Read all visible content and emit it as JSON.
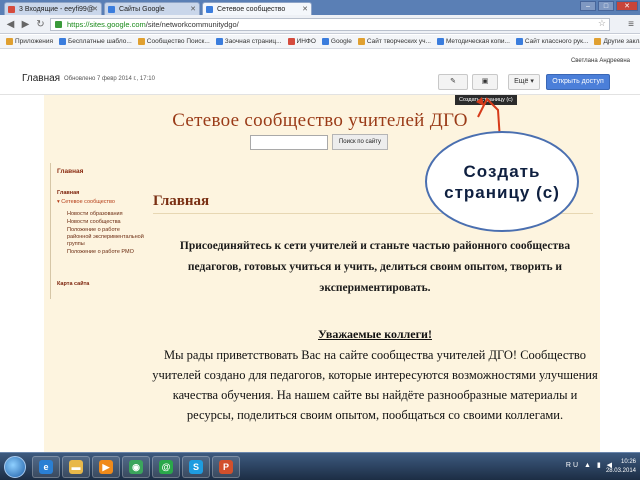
{
  "tabs": [
    {
      "label": "3 Входящие - eeyfi99@",
      "favicon_color": "#d54b3d"
    },
    {
      "label": "Сайты Google",
      "favicon_color": "#3b7ddd"
    },
    {
      "label": "Сетевое сообщество",
      "favicon_color": "#3b7ddd",
      "active": true
    }
  ],
  "address": {
    "scheme": "https://",
    "host": "sites.google.com",
    "path": "/site/networkcommunitydgo/"
  },
  "bookmarks": [
    {
      "label": "Приложения",
      "color": "#e0a030"
    },
    {
      "label": "Бесплатные шабло...",
      "color": "#3b7ddd"
    },
    {
      "label": "Сообщество Поиск...",
      "color": "#e0a030"
    },
    {
      "label": "Заочная страниц...",
      "color": "#3b7ddd"
    },
    {
      "label": "ИНФО",
      "color": "#d54b3d"
    },
    {
      "label": "Google",
      "color": "#3b7ddd"
    },
    {
      "label": "Сайт творческих уч...",
      "color": "#e0a030"
    },
    {
      "label": "Методическая копи...",
      "color": "#3b7ddd"
    },
    {
      "label": "Сайт классного рук...",
      "color": "#3b7ddd"
    },
    {
      "label": "Другие закладки",
      "color": "#e0a030"
    }
  ],
  "header": {
    "user": "Светлана Андреевна",
    "page_title": "Главная",
    "edited": "Обновлено 7 февр 2014 г., 17:10",
    "edit_icon": "pencil-icon",
    "new_page_icon": "new-page-icon",
    "more_label": "Ещё",
    "share_label": "Открыть доступ",
    "tooltip": "Создать страницу (c)"
  },
  "site": {
    "title": "Сетевое сообщество учителей ДГО",
    "search_button": "Поиск по сайту",
    "sidebar_heading": "Главная",
    "sidebar_items": [
      {
        "label": "Главная",
        "style": "b"
      },
      {
        "label": "▾ Сетевое сообщество",
        "style": "link"
      },
      {
        "label": "Новости образования",
        "style": ""
      },
      {
        "label": "Новости сообщества",
        "style": ""
      },
      {
        "label": "Положение о работе",
        "style": ""
      },
      {
        "label": "районной экспериментальной",
        "style": ""
      },
      {
        "label": "группы",
        "style": ""
      },
      {
        "label": "Положение о работе РМО",
        "style": ""
      },
      {
        "label": "Карта сайта",
        "style": "b"
      }
    ],
    "heading": "Главная",
    "intro": "Присоединяйтесь к сети учителей и станьте частью районного сообщества педагогов, готовых учиться и учить, делиться своим опытом, творить и экспериментировать.",
    "greeting": "Уважаемые коллеги!",
    "welcome": "Мы рады приветствовать Вас на сайте сообщества учителей ДГО! Сообщество учителей создано для педагогов, которые интересуются возможностями улучшения качества обучения. На нашем сайте вы найдёте разнообразные материалы и ресурсы, поделиться своим опытом, пообщаться со своими коллегами."
  },
  "callout": {
    "text": "Создать страницу (c)"
  },
  "taskbar": {
    "apps": [
      {
        "icon": "explorer-icon",
        "glyph": "e",
        "color": "#2a7fd4"
      },
      {
        "icon": "folder-icon",
        "glyph": "▬",
        "color": "#e8b84a"
      },
      {
        "icon": "media-player-icon",
        "glyph": "▶",
        "color": "#f08a1a"
      },
      {
        "icon": "chrome-icon",
        "glyph": "◉",
        "color": "#3ba55c"
      },
      {
        "icon": "mail-agent-icon",
        "glyph": "@",
        "color": "#2aa84a"
      },
      {
        "icon": "skype-icon",
        "glyph": "S",
        "color": "#1e9ce0"
      },
      {
        "icon": "powerpoint-icon",
        "glyph": "P",
        "color": "#d2502c"
      }
    ],
    "tray": "RU ▲ ▮ ◀",
    "time": "10:26",
    "date": "28.03.2014"
  }
}
